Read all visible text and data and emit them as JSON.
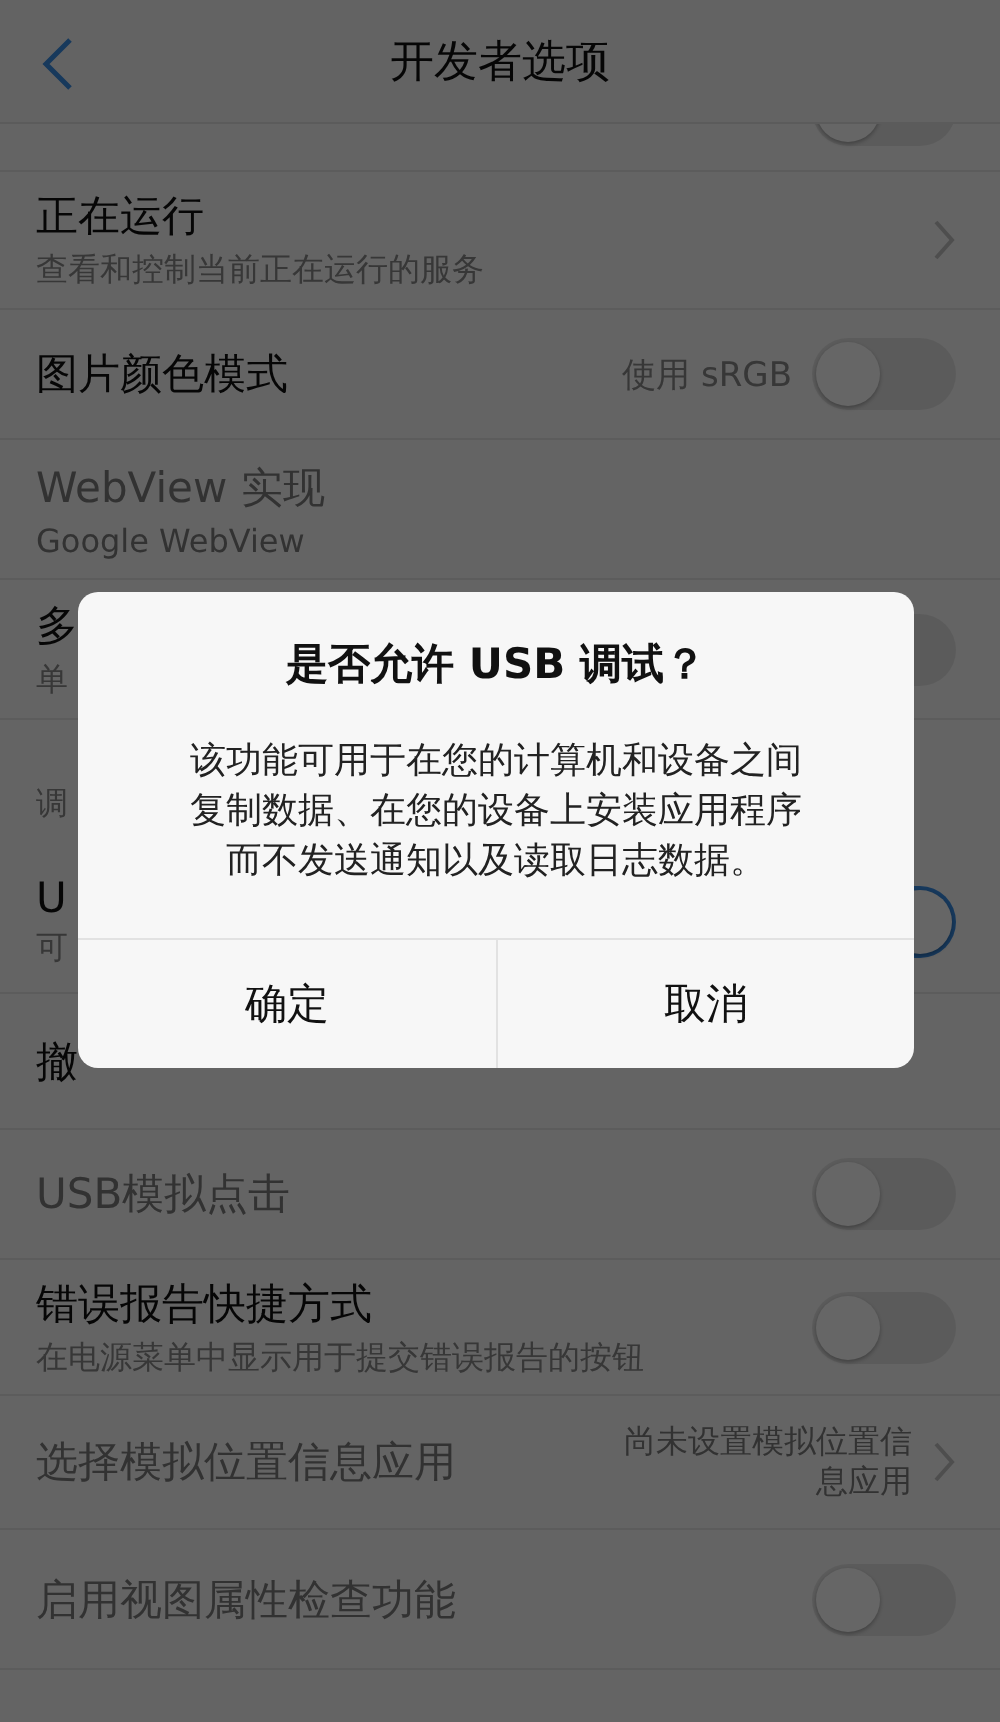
{
  "header": {
    "title": "开发者选项"
  },
  "rows": [
    {
      "kind": "toggle",
      "on": false
    },
    {
      "kind": "link",
      "title": "正在运行",
      "subtitle": "查看和控制当前正在运行的服务",
      "disabled": false
    },
    {
      "kind": "toggle",
      "title": "图片颜色模式",
      "value": "使用 sRGB",
      "on": false,
      "disabled": false
    },
    {
      "kind": "plain",
      "title": "WebView 实现",
      "subtitle": "Google WebView",
      "disabled": true
    },
    {
      "kind": "toggle",
      "title": "多",
      "subtitle": "单",
      "on": false,
      "disabled": false
    },
    {
      "kind": "section",
      "title": "调"
    },
    {
      "kind": "toggle",
      "title": "U",
      "subtitle": "可",
      "on": true,
      "disabled": false
    },
    {
      "kind": "plain",
      "title": "撤",
      "disabled": false
    },
    {
      "kind": "toggle",
      "title": "USB模拟点击",
      "on": false,
      "disabled": true
    },
    {
      "kind": "toggle",
      "title": "错误报告快捷方式",
      "subtitle": "在电源菜单中显示用于提交错误报告的按钮",
      "on": false,
      "disabled": false
    },
    {
      "kind": "link",
      "title": "选择模拟位置信息应用",
      "value": "尚未设置模拟位置信息应用",
      "disabled": true
    },
    {
      "kind": "toggle",
      "title": "启用视图属性检查功能",
      "on": false,
      "disabled": true
    }
  ],
  "dialog": {
    "title": "是否允许 USB 调试？",
    "message": "该功能可用于在您的计算机和设备之间复制数据、在您的设备上安装应用程序而不发送通知以及读取日志数据。",
    "buttons": [
      "确定",
      "取消"
    ]
  }
}
